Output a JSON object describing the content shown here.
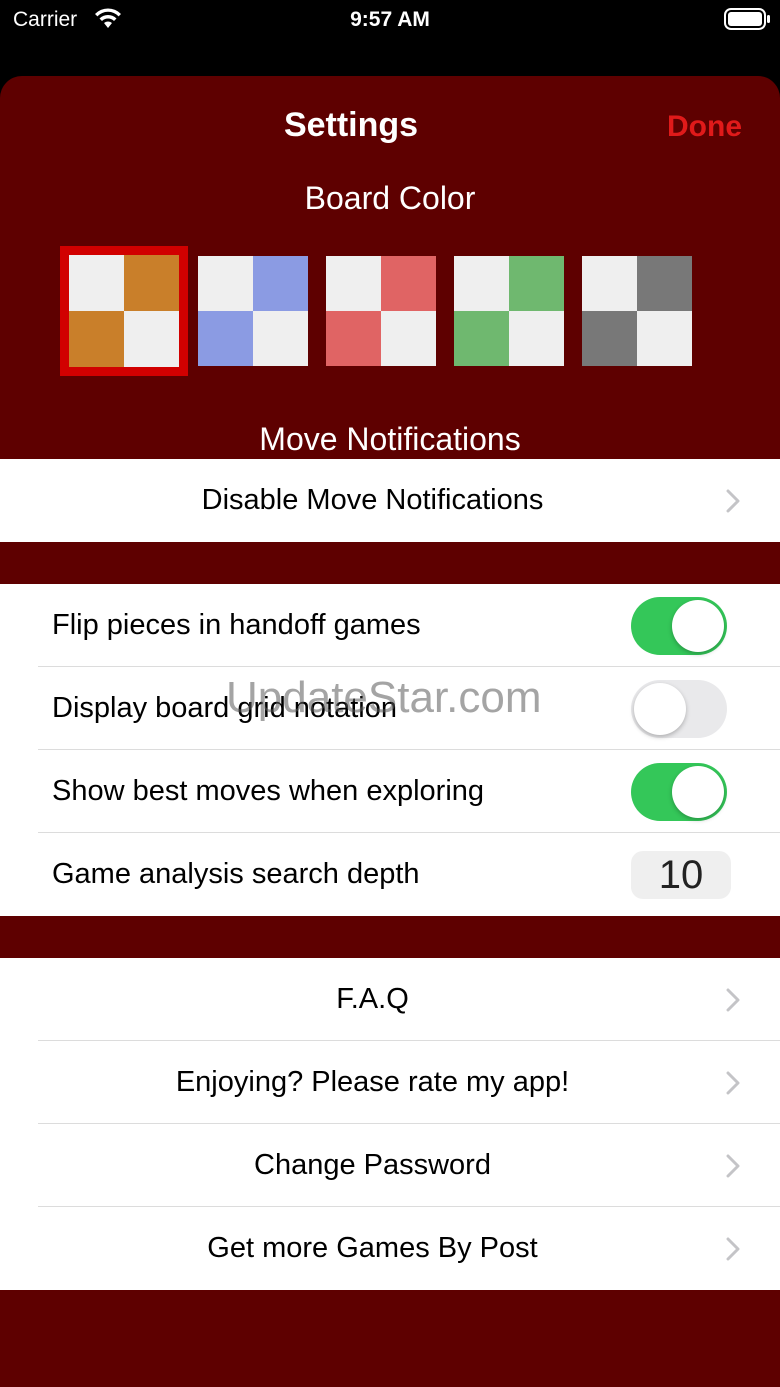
{
  "status_bar": {
    "carrier": "Carrier",
    "time": "9:57 AM"
  },
  "nav": {
    "title": "Settings",
    "done_label": "Done"
  },
  "board_color": {
    "header": "Board Color",
    "swatches": [
      {
        "name": "wood",
        "light": "#efefef",
        "dark": "#c97f2a",
        "selected": true
      },
      {
        "name": "blue",
        "light": "#efefef",
        "dark": "#8b9be3",
        "selected": false
      },
      {
        "name": "red",
        "light": "#efefef",
        "dark": "#e06464",
        "selected": false
      },
      {
        "name": "green",
        "light": "#efefef",
        "dark": "#6fb86f",
        "selected": false
      },
      {
        "name": "gray",
        "light": "#efefef",
        "dark": "#787878",
        "selected": false
      }
    ]
  },
  "move_notifications": {
    "header": "Move Notifications",
    "disable_label": "Disable Move Notifications"
  },
  "options": {
    "flip_pieces": {
      "label": "Flip pieces in handoff games",
      "on": true
    },
    "grid_notation": {
      "label": "Display board grid notation",
      "on": false
    },
    "best_moves": {
      "label": "Show best moves when exploring",
      "on": true
    },
    "search_depth": {
      "label": "Game analysis search depth",
      "value": "10"
    }
  },
  "links": {
    "faq": "F.A.Q",
    "rate": "Enjoying? Please rate my app!",
    "change_password": "Change Password",
    "more_games": "Get more Games By Post"
  },
  "watermark": "UpdateStar.com",
  "colors": {
    "background": "#5e0000",
    "accent": "#e01a1a",
    "toggle_on": "#34c759"
  }
}
